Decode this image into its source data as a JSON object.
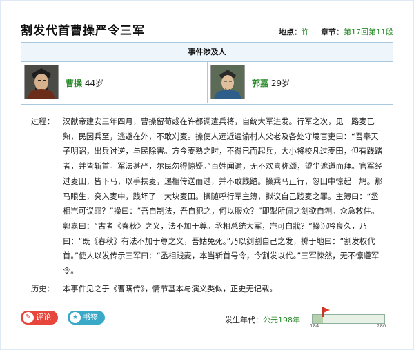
{
  "header": {
    "title": "割发代首曹操严令三军",
    "location_label": "地点：",
    "location_value": "许",
    "chapter_label": "章节：",
    "chapter_value": "第17回第11段"
  },
  "people": {
    "heading": "事件涉及人",
    "list": [
      {
        "name": "曹操",
        "age": "44岁"
      },
      {
        "name": "郭嘉",
        "age": "29岁"
      }
    ]
  },
  "story": {
    "process_label": "过程：",
    "process_text": "汉献帝建安三年四月，曹操留荀彧在许都调遣兵将，自统大军进发。行军之次，见一路麦已熟，民因兵至，逃避在外，不敢刈麦。操使人远近遍谕村人父老及各处守境官吏曰：“吾奉天子明诏，出兵讨逆，与民除害。方今麦熟之时，不得已而起兵，大小将校凡过麦田，但有践踏者，并皆斩首。军法甚严，尔民勿得惊疑。”百姓闻谕，无不欢喜称颂，望尘遮道而拜。官军经过麦田，皆下马，以手扶麦，递相传送而过，并不敢践踏。操乘马正行，忽田中惊起一鸠。那马眼生，突入麦中，践坏了一大块麦田。操随呼行军主簿，拟议自己践麦之罪。主簿曰：“丞相岂可议罪？”操曰：“吾自制法，吾自犯之，何以服众？”即掣所佩之剑欲自刎。众急救住。郭嘉曰：“古者《春秋》之义，法不加于尊。丞相总统大军，岂可自戕？”操沉吟良久，乃曰：“既《春秋》有法不加于尊之义，吾姑免死。”乃以剑割自己之发，掷于地曰：“割发权代首。”使人以发传示三军曰：“丞相践麦，本当斩首号令，今割发以代。”三军悚然，无不懔遵军令。",
    "history_label": "历史：",
    "history_text": "本事件见之于《曹瞒传》，情节基本与演义类似，正史无记载。"
  },
  "footer": {
    "comment_label": "评论",
    "bookmark_label": "书签",
    "year_label": "发生年代：",
    "year_value": "公元198年",
    "timeline_start": "184",
    "timeline_end": "280",
    "timeline_position": 0.146
  }
}
